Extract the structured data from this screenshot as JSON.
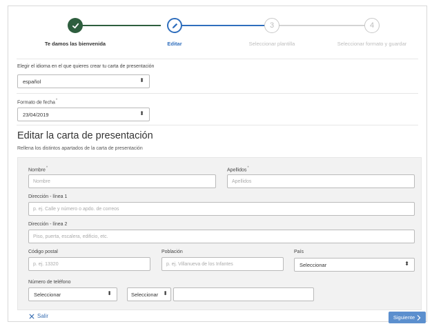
{
  "stepper": {
    "steps": [
      {
        "label": "Te damos las bienvenida",
        "number": "",
        "state": "done"
      },
      {
        "label": "Editar",
        "number": "",
        "state": "active"
      },
      {
        "label": "Seleccionar plantilla",
        "number": "3",
        "state": "pending"
      },
      {
        "label": "Seleccionar formato y guardar",
        "number": "4",
        "state": "pending"
      }
    ],
    "colors": {
      "done": "#2e5e3e",
      "active": "#2f6ebd",
      "pending": "#c8c8c8"
    }
  },
  "language": {
    "label": "Elegir el idioma en el que quieres crear tu carta de presentación",
    "value": "español"
  },
  "date_format": {
    "label": "Formato de fecha",
    "required_mark": "*",
    "value": "23/04/2019"
  },
  "editor": {
    "title": "Editar la carta de presentación",
    "subtitle": "Rellena los distintos apartados de la carta de presentación"
  },
  "form": {
    "nombre": {
      "label": "Nombre",
      "required_mark": "*",
      "placeholder": "Nombre"
    },
    "apellidos": {
      "label": "Apellidos",
      "required_mark": "*",
      "placeholder": "Apellidos"
    },
    "direccion1": {
      "label": "Dirección - línea 1",
      "placeholder": "p. ej. Calle y número o apdo. de correos"
    },
    "direccion2": {
      "label": "Dirección - línea 2",
      "placeholder": "Piso, puerta, escalera, edificio, etc."
    },
    "codigo_postal": {
      "label": "Código postal",
      "placeholder": "p. ej. 13320"
    },
    "poblacion": {
      "label": "Población",
      "placeholder": "p. ej. Villanueva de los Infantes"
    },
    "pais": {
      "label": "País",
      "value": "Seleccionar"
    },
    "telefono": {
      "label": "Número de teléfono",
      "type_value": "Seleccionar",
      "prefix_value": "Seleccionar",
      "number": ""
    }
  },
  "footer": {
    "exit_label": "Salir",
    "next_label": "Siguiente"
  },
  "icons": {
    "check": "check-icon",
    "pencil": "pencil-icon",
    "close": "close-icon",
    "chevron": "chevron-right-icon",
    "caret": "select-caret-icon"
  }
}
